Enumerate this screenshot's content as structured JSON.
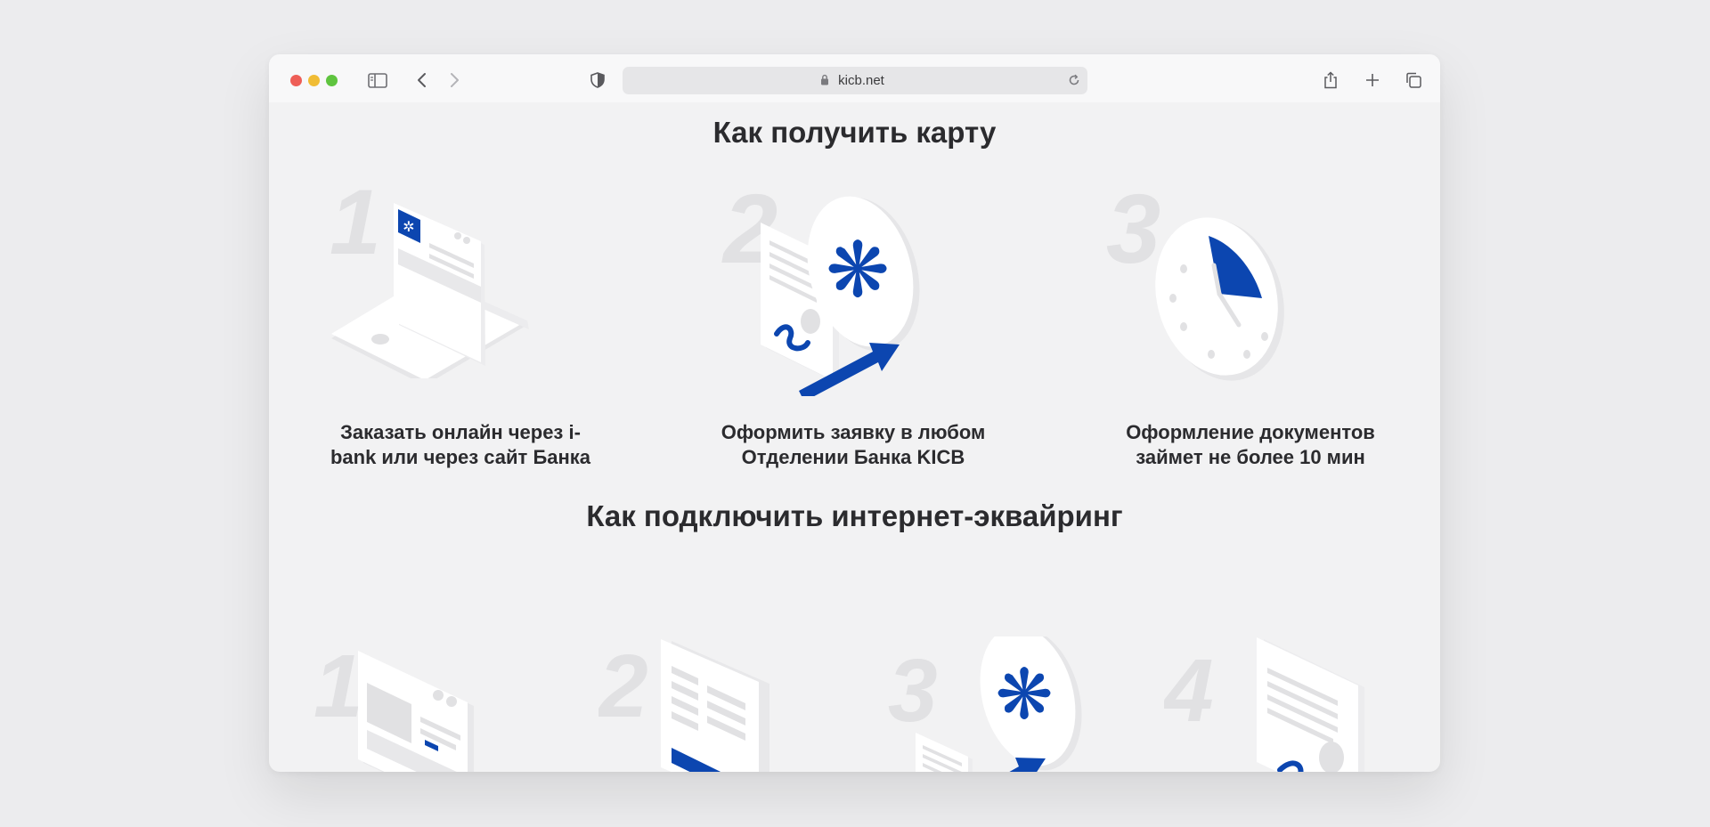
{
  "browser": {
    "url": "kicb.net"
  },
  "card_section": {
    "title": "Как получить карту",
    "steps": [
      {
        "number": "1",
        "caption_line1": "Заказать онлайн через i-",
        "caption_line2": "bank или через сайт Банка"
      },
      {
        "number": "2",
        "caption_line1": "Оформить заявку в любом",
        "caption_line2": "Отделении Банка KICB"
      },
      {
        "number": "3",
        "caption_line1": "Оформление документов",
        "caption_line2": "займет не более 10 мин"
      }
    ]
  },
  "acquiring_section": {
    "title": "Как подключить интернет-эквайринг",
    "steps": [
      {
        "number": "1"
      },
      {
        "number": "2"
      },
      {
        "number": "3"
      },
      {
        "number": "4"
      }
    ]
  },
  "colors": {
    "accent_blue": "#0c46b0",
    "page_background": "#f2f2f3",
    "illustration_white": "#ffffff",
    "illustration_gray": "#e1e1e3"
  }
}
